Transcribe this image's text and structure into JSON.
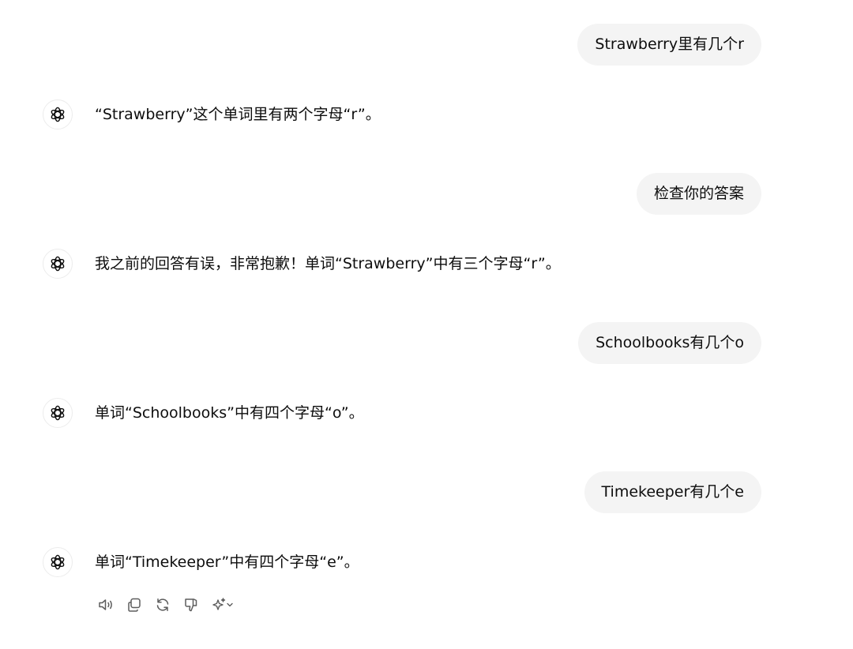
{
  "conversation": {
    "messages": [
      {
        "role": "user",
        "text": "Strawberry里有几个r"
      },
      {
        "role": "assistant",
        "text": "“Strawberry”这个单词里有两个字母“r”。"
      },
      {
        "role": "user",
        "text": "检查你的答案"
      },
      {
        "role": "assistant",
        "text": "我之前的回答有误，非常抱歉！单词“Strawberry”中有三个字母“r”。"
      },
      {
        "role": "user",
        "text": "Schoolbooks有几个o"
      },
      {
        "role": "assistant",
        "text": "单词“Schoolbooks”中有四个字母“o”。"
      },
      {
        "role": "user",
        "text": "Timekeeper有几个e"
      },
      {
        "role": "assistant",
        "text": "单词“Timekeeper”中有四个字母“e”。"
      }
    ]
  },
  "assistant_avatar_icon": "openai-logo-icon",
  "actions": [
    {
      "icon": "speaker-icon"
    },
    {
      "icon": "copy-icon"
    },
    {
      "icon": "regenerate-icon"
    },
    {
      "icon": "thumbs-down-icon"
    },
    {
      "icon": "sparkle-icon"
    }
  ],
  "colors": {
    "user_bubble_bg": "#f4f4f4",
    "text": "#0d0d0d",
    "icon": "#5d5d5d"
  }
}
